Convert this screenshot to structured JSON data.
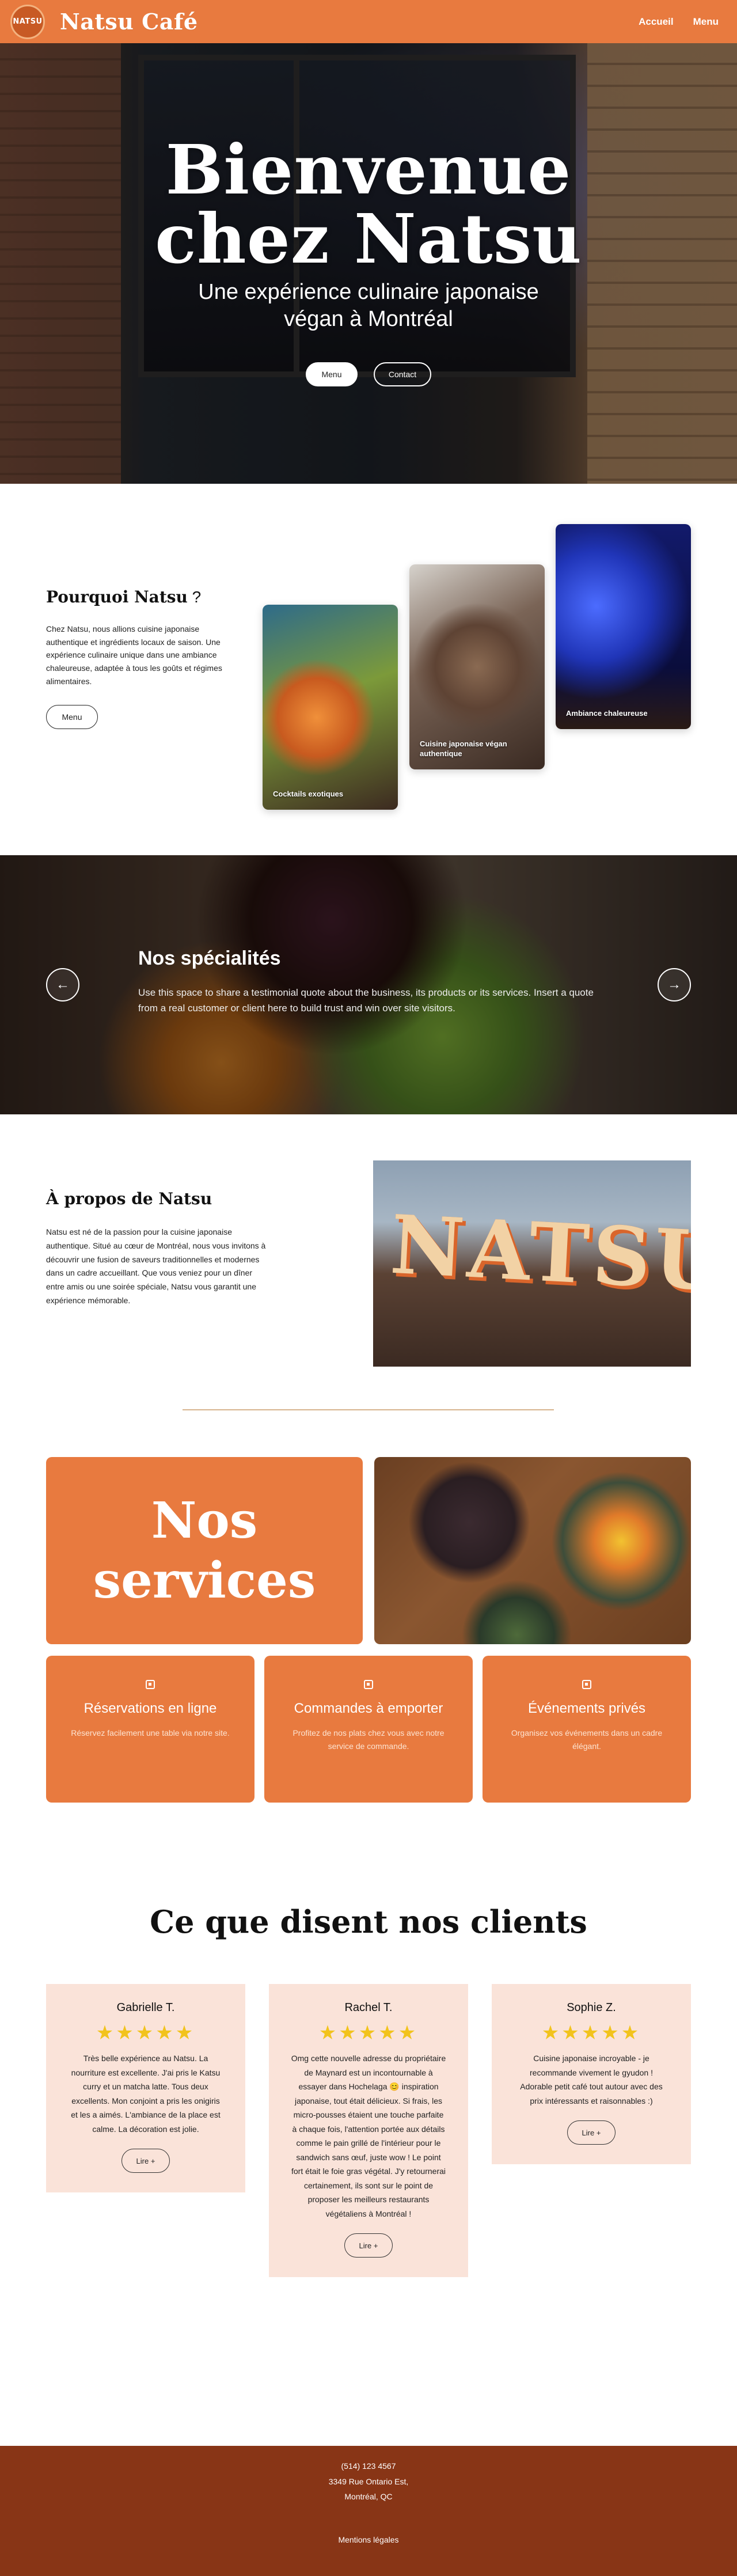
{
  "header": {
    "logo_text": "NATSU",
    "brand": "Natsu Café",
    "nav": [
      {
        "label": "Accueil"
      },
      {
        "label": "Menu"
      }
    ]
  },
  "hero": {
    "title_line1": "Bienvenue",
    "title_line2": "chez Natsu",
    "subtitle_line1": "Une expérience culinaire japonaise",
    "subtitle_line2": "végan à Montréal",
    "button_menu": "Menu",
    "button_contact": "Contact"
  },
  "why": {
    "title": "Pourquoi Natsu",
    "title_q": " ?",
    "text": "Chez Natsu, nous allions cuisine japonaise authentique et ingrédients locaux de saison. Une expérience culinaire unique dans une ambiance chaleureuse, adaptée à tous les goûts et régimes alimentaires.",
    "button": "Menu",
    "cards": [
      {
        "caption": "Cocktails exotiques"
      },
      {
        "caption": "Cuisine japonaise végan authentique"
      },
      {
        "caption": "Ambiance chaleureuse"
      }
    ]
  },
  "specialties": {
    "title": "Nos spécialités",
    "text": "Use this space to share a testimonial quote about the business, its products or its services. Insert a quote from a real customer or client here to build trust and win over site visitors.",
    "prev": "←",
    "next": "→"
  },
  "about": {
    "title": "À propos de Natsu",
    "text": "Natsu est né de la passion pour la cuisine japonaise authentique. Situé au cœur de Montréal, nous vous invitons à découvrir une fusion de saveurs traditionnelles et modernes dans un cadre accueillant. Que vous veniez pour un dîner entre amis ou une soirée spéciale, Natsu vous garantit une expérience mémorable.",
    "sign_text": "NATSU"
  },
  "services": {
    "title_line1": "Nos",
    "title_line2": "services",
    "cards": [
      {
        "title": "Réservations en ligne",
        "text": "Réservez facilement une table via notre site."
      },
      {
        "title": "Commandes à emporter",
        "text": "Profitez de nos plats chez vous avec notre service de commande."
      },
      {
        "title": "Événements privés",
        "text": "Organisez vos événements dans un cadre élégant."
      }
    ]
  },
  "testimonials": {
    "title": "Ce que disent nos clients",
    "stars": "★★★★★",
    "button": "Lire +",
    "rating": 5,
    "items": [
      {
        "name": "Gabrielle T.",
        "text": "Très belle expérience au Natsu. La nourriture est excellente. J'ai pris le Katsu curry et un matcha latte. Tous deux excellents. Mon conjoint a pris les onigiris et les a aimés. L'ambiance de la place est calme. La décoration est jolie."
      },
      {
        "name": "Rachel T.",
        "text": "Omg cette nouvelle adresse du propriétaire de Maynard est un incontournable à essayer dans Hochelaga 😊 inspiration japonaise, tout était délicieux. Si frais, les micro-pousses étaient une touche parfaite à chaque fois, l'attention portée aux détails comme le pain grillé de l'intérieur pour le sandwich sans œuf, juste wow ! Le point fort était le foie gras végétal. J'y retournerai certainement, ils sont sur le point de proposer les meilleurs restaurants végétaliens à Montréal !"
      },
      {
        "name": "Sophie Z.",
        "text": "Cuisine japonaise incroyable - je recommande vivement le gyudon ! Adorable petit café tout autour avec des prix intéressants et raisonnables :)"
      }
    ]
  },
  "footer": {
    "phone": "(514) 123 4567",
    "address_line1": "3349 Rue Ontario Est,",
    "address_line2": "Montréal, QC",
    "legal": "Mentions légales"
  },
  "colors": {
    "accent": "#e87a3f",
    "footer": "#883516",
    "card_bg": "#fae3d9",
    "star": "#f2c31c"
  }
}
